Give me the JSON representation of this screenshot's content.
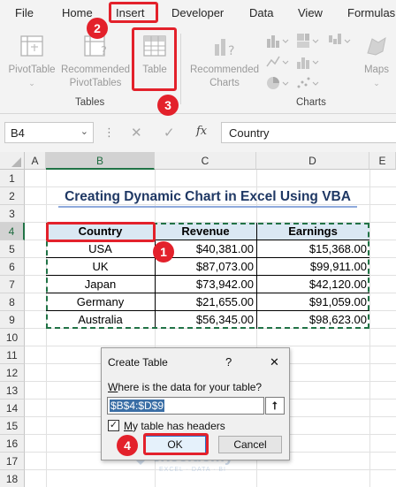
{
  "ribbon": {
    "tabs": [
      "File",
      "Home",
      "Insert",
      "Developer",
      "Data",
      "View",
      "Formulas"
    ],
    "commands": {
      "pivot_table": "PivotTable",
      "recommended_pivot_line1": "Recommended",
      "recommended_pivot_line2": "PivotTables",
      "table": "Table",
      "recommended_charts_line1": "Recommended",
      "recommended_charts_line2": "Charts",
      "maps": "Maps"
    },
    "groups": {
      "tables": "Tables",
      "charts": "Charts"
    }
  },
  "formula_bar": {
    "name_box": "B4",
    "fx": "fx",
    "content": "Country"
  },
  "grid": {
    "columns": [
      "A",
      "B",
      "C",
      "D",
      "E"
    ],
    "rows": [
      "1",
      "2",
      "3",
      "4",
      "5",
      "6",
      "7",
      "8",
      "9",
      "10",
      "11",
      "12",
      "13",
      "14",
      "15",
      "16",
      "17",
      "18"
    ],
    "selected_column": "B",
    "selected_row": "4"
  },
  "sheet": {
    "title": "Creating Dynamic Chart in Excel Using VBA",
    "table": {
      "headers": [
        "Country",
        "Revenue",
        "Earnings"
      ],
      "rows": [
        [
          "USA",
          "$40,381.00",
          "$15,368.00"
        ],
        [
          "UK",
          "$87,073.00",
          "$99,911.00"
        ],
        [
          "Japan",
          "$73,942.00",
          "$42,120.00"
        ],
        [
          "Germany",
          "$21,655.00",
          "$91,059.00"
        ],
        [
          "Australia",
          "$56,345.00",
          "$98,623.00"
        ]
      ]
    }
  },
  "dialog": {
    "title": "Create Table",
    "help": "?",
    "close": "✕",
    "prompt_prefix": "W",
    "prompt_rest": "here is the data for your table?",
    "range_value": "$B$4:$D$9",
    "checkbox_prefix": "M",
    "checkbox_rest": "y table has headers",
    "checkbox_checked": true,
    "ok": "OK",
    "cancel": "Cancel"
  },
  "annotations": [
    "1",
    "2",
    "3",
    "4"
  ],
  "watermark": {
    "name": "exceldemy",
    "tagline": "EXCEL · DATA · BI"
  },
  "colors": {
    "accent_green": "#217346",
    "annotation_red": "#e3212b",
    "title_blue": "#1f3864",
    "header_fill": "#dae8f3"
  }
}
